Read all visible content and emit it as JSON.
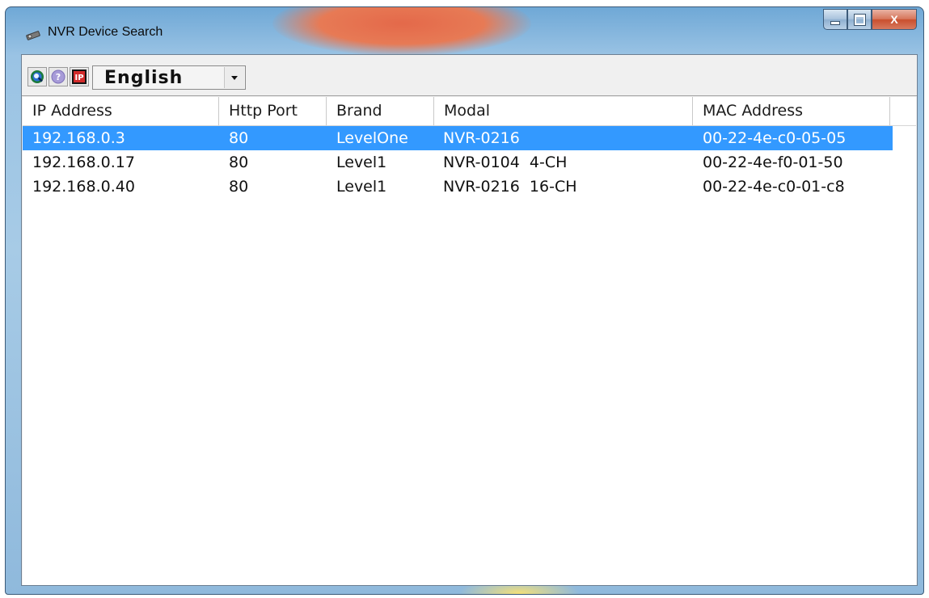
{
  "window": {
    "title": "NVR Device Search",
    "colors": {
      "selection": "#3399ff",
      "close_button": "#c94f2e",
      "frame": "#9ac3e4"
    }
  },
  "caption_buttons": {
    "close_label": "X"
  },
  "toolbar": {
    "icons": [
      "search-icon",
      "help-icon",
      "ip-icon"
    ],
    "ip_label": "IP",
    "language": {
      "selected": "English"
    }
  },
  "table": {
    "columns": [
      "IP Address",
      "Http Port",
      "Brand",
      "Modal",
      "MAC Address"
    ],
    "rows": [
      {
        "ip": "192.168.0.3",
        "port": "80",
        "brand": "LevelOne",
        "modal": "NVR-0216",
        "mac": "00-22-4e-c0-05-05",
        "selected": true
      },
      {
        "ip": "192.168.0.17",
        "port": "80",
        "brand": "Level1",
        "modal": "NVR-0104  4-CH",
        "mac": "00-22-4e-f0-01-50",
        "selected": false
      },
      {
        "ip": "192.168.0.40",
        "port": "80",
        "brand": "Level1",
        "modal": "NVR-0216  16-CH",
        "mac": "00-22-4e-c0-01-c8",
        "selected": false
      }
    ]
  }
}
